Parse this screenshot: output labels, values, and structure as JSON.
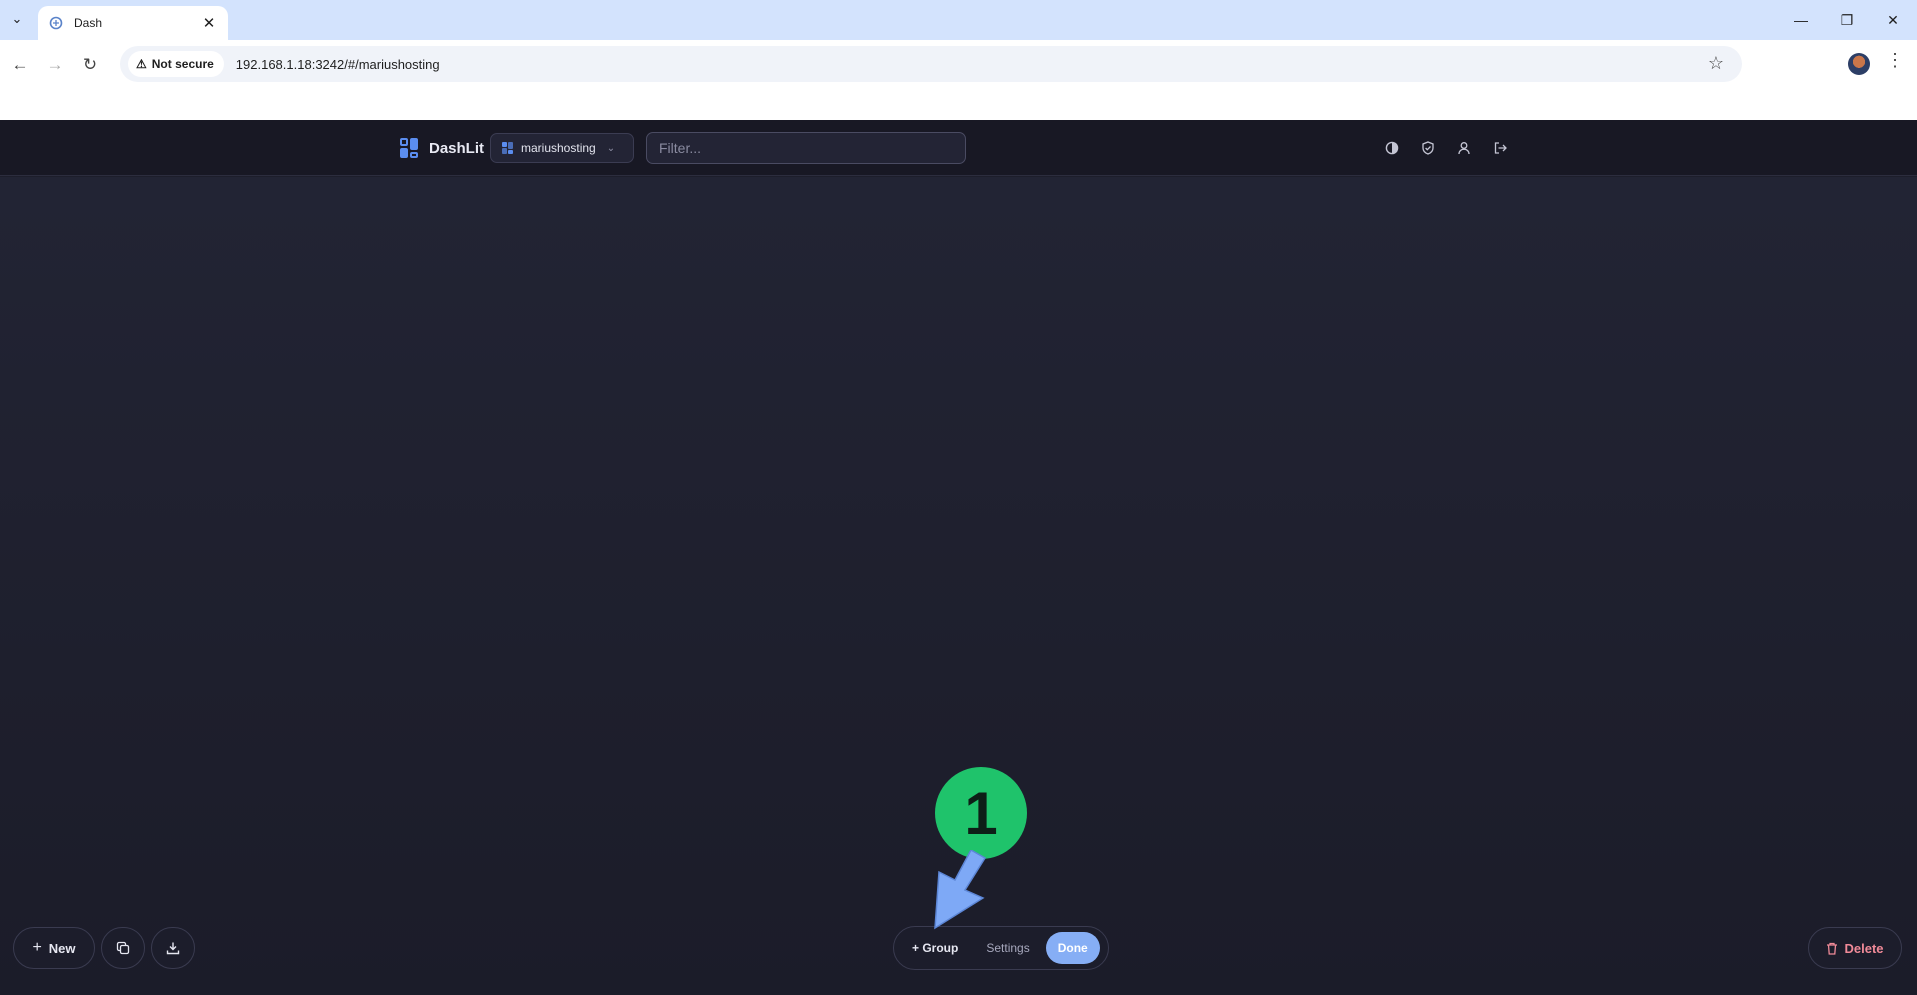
{
  "browser": {
    "tab_title": "Dash",
    "secure_label": "Not secure",
    "url": "192.168.1.18:3242/#/mariushosting"
  },
  "header": {
    "brand": "DashLit",
    "board_name": "mariushosting",
    "filter_placeholder": "Filter...",
    "icons": [
      "theme-icon",
      "shield-icon",
      "user-icon",
      "logout-icon"
    ]
  },
  "bottom_left": {
    "new_label": "New",
    "icons": [
      "duplicate-icon",
      "download-icon"
    ]
  },
  "edit_bar": {
    "group_label": "+ Group",
    "settings_label": "Settings",
    "done_label": "Done"
  },
  "bottom_right": {
    "delete_label": "Delete"
  },
  "annotation": {
    "step_number": "1",
    "badge_color": "#1fc36b",
    "arrow_color": "#7ea9f6"
  },
  "colors": {
    "accent": "#86aef5",
    "danger": "#f08a98",
    "background": "#1d1e2b"
  }
}
